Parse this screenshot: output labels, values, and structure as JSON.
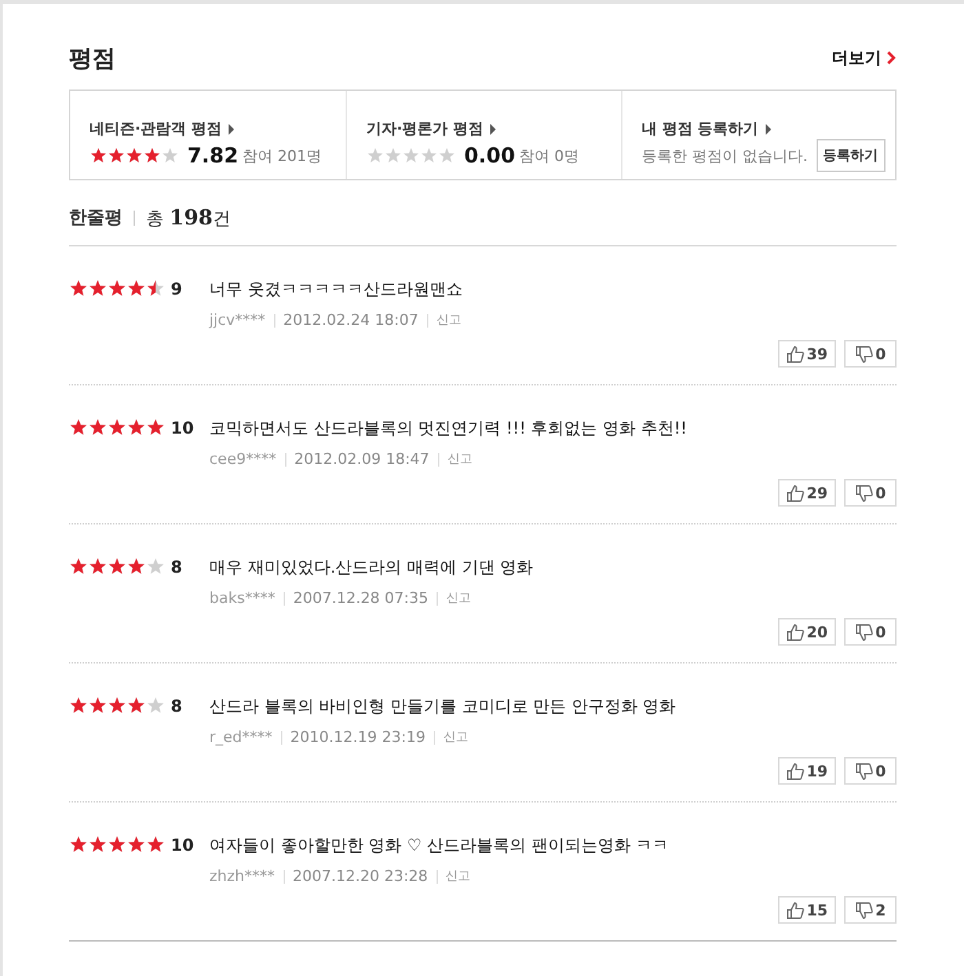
{
  "header": {
    "title": "평점",
    "more_link": "더보기"
  },
  "summary": [
    {
      "kind": "score",
      "label": "네티즌·관람객 평점",
      "stars": 4,
      "score": "7.82",
      "participants": "참여 201명"
    },
    {
      "kind": "score",
      "label": "기자·평론가 평점",
      "stars": 0,
      "score": "0.00",
      "participants": "참여 0명"
    },
    {
      "kind": "register",
      "label": "내 평점 등록하기",
      "message": "등록한 평점이 없습니다.",
      "button": "등록하기"
    }
  ],
  "reviews_header": {
    "title": "한줄평",
    "total_prefix": "총",
    "total": "198",
    "total_suffix": "건"
  },
  "reviews": [
    {
      "stars": 4.5,
      "score": "9",
      "text": "너무 웃겼ㅋㅋㅋㅋㅋ산드라원맨쇼",
      "user": "jjcv****",
      "date": "2012.02.24 18:07",
      "report": "신고",
      "likes": "39",
      "dislikes": "0"
    },
    {
      "stars": 5,
      "score": "10",
      "text": "코믹하면서도 산드라블록의 멋진연기력 !!! 후회없는 영화 추천!!",
      "user": "cee9****",
      "date": "2012.02.09 18:47",
      "report": "신고",
      "likes": "29",
      "dislikes": "0"
    },
    {
      "stars": 4,
      "score": "8",
      "text": "매우 재미있었다.산드라의 매력에 기댄 영화",
      "user": "baks****",
      "date": "2007.12.28 07:35",
      "report": "신고",
      "likes": "20",
      "dislikes": "0"
    },
    {
      "stars": 4,
      "score": "8",
      "text": "산드라 블록의 바비인형 만들기를 코미디로 만든 안구정화 영화",
      "user": "r_ed****",
      "date": "2010.12.19 23:19",
      "report": "신고",
      "likes": "19",
      "dislikes": "0"
    },
    {
      "stars": 5,
      "score": "10",
      "text": "여자들이 좋아할만한 영화 ♡ 산드라블록의 팬이되는영화 ㅋㅋ",
      "user": "zhzh****",
      "date": "2007.12.20 23:28",
      "report": "신고",
      "likes": "15",
      "dislikes": "2"
    }
  ]
}
